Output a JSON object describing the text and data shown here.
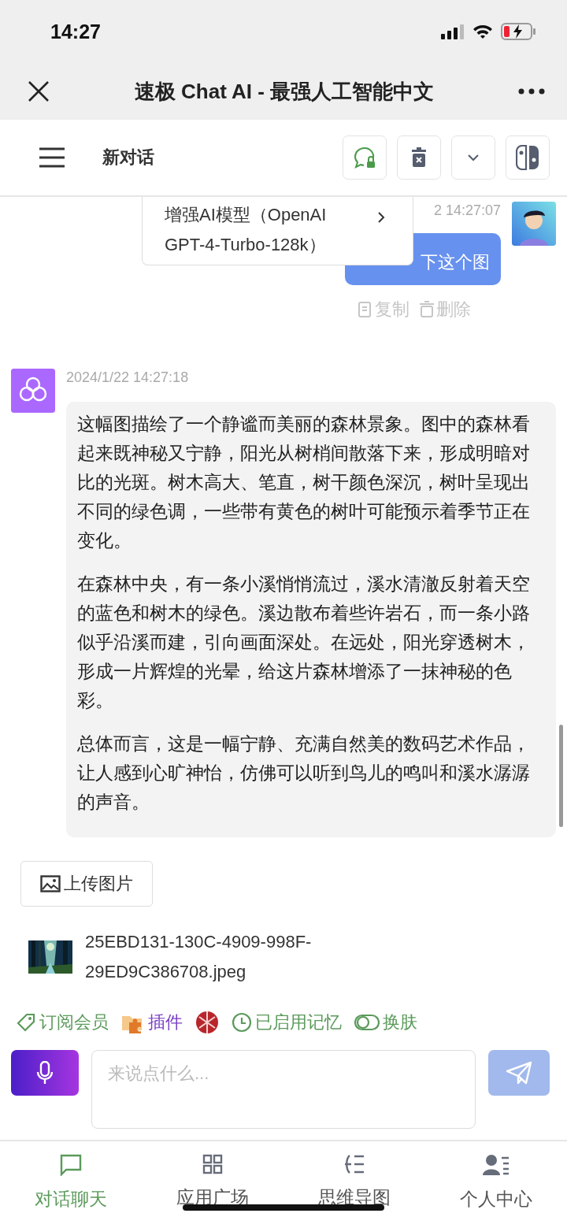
{
  "status_bar": {
    "time": "14:27"
  },
  "browser_bar": {
    "title": "速极 Chat AI - 最强人工智能中文"
  },
  "toolbar": {
    "title": "新对话"
  },
  "model_popup": {
    "label": "增强AI模型（OpenAI GPT-4-Turbo-128k）"
  },
  "messages": [
    {
      "kind": "user",
      "time": "2 14:27:07",
      "paragraphs": [
        "下这个图"
      ],
      "actions": [
        "复制",
        "删除"
      ]
    },
    {
      "kind": "assistant",
      "time": "2024/1/22 14:27:18",
      "paragraphs": [
        "这幅图描绘了一个静谧而美丽的森林景象。图中的森林看起来既神秘又宁静，阳光从树梢间散落下来，形成明暗对比的光斑。树木高大、笔直，树干颜色深沉，树叶呈现出不同的绿色调，一些带有黄色的树叶可能预示着季节正在变化。",
        "在森林中央，有一条小溪悄悄流过，溪水清澈反射着天空的蓝色和树木的绿色。溪边散布着些许岩石，而一条小路似乎沿溪而建，引向画面深处。在远处，阳光穿透树木，形成一片辉煌的光晕，给这片森林增添了一抹神秘的色彩。",
        "总体而言，这是一幅宁静、充满自然美的数码艺术作品，让人感到心旷神怡，仿佛可以听到鸟儿的鸣叫和溪水潺潺的声音。"
      ]
    }
  ],
  "upload_button": {
    "label": "上传图片"
  },
  "attachment": {
    "filename": "25EBD131-130C-4909-998F-29ED9C386708.jpeg"
  },
  "tools": [
    {
      "kind": "tag",
      "label": "订阅会员",
      "color": "#5b9a5b"
    },
    {
      "kind": "plugin",
      "label": "插件",
      "color": "#7a3fc4"
    },
    {
      "kind": "ball"
    },
    {
      "kind": "clock",
      "label": "已启用记忆",
      "color": "#5b9a5b"
    },
    {
      "kind": "toggle",
      "label": "换肤",
      "color": "#5b9a5b"
    }
  ],
  "composer": {
    "placeholder": "来说点什么..."
  },
  "tabs": [
    {
      "kind": "chat",
      "label": "对话聊天",
      "selected": true
    },
    {
      "kind": "grid",
      "label": "应用广场",
      "selected": false
    },
    {
      "kind": "mindmap",
      "label": "思维导图",
      "selected": false
    },
    {
      "kind": "person",
      "label": "个人中心",
      "selected": false
    }
  ]
}
